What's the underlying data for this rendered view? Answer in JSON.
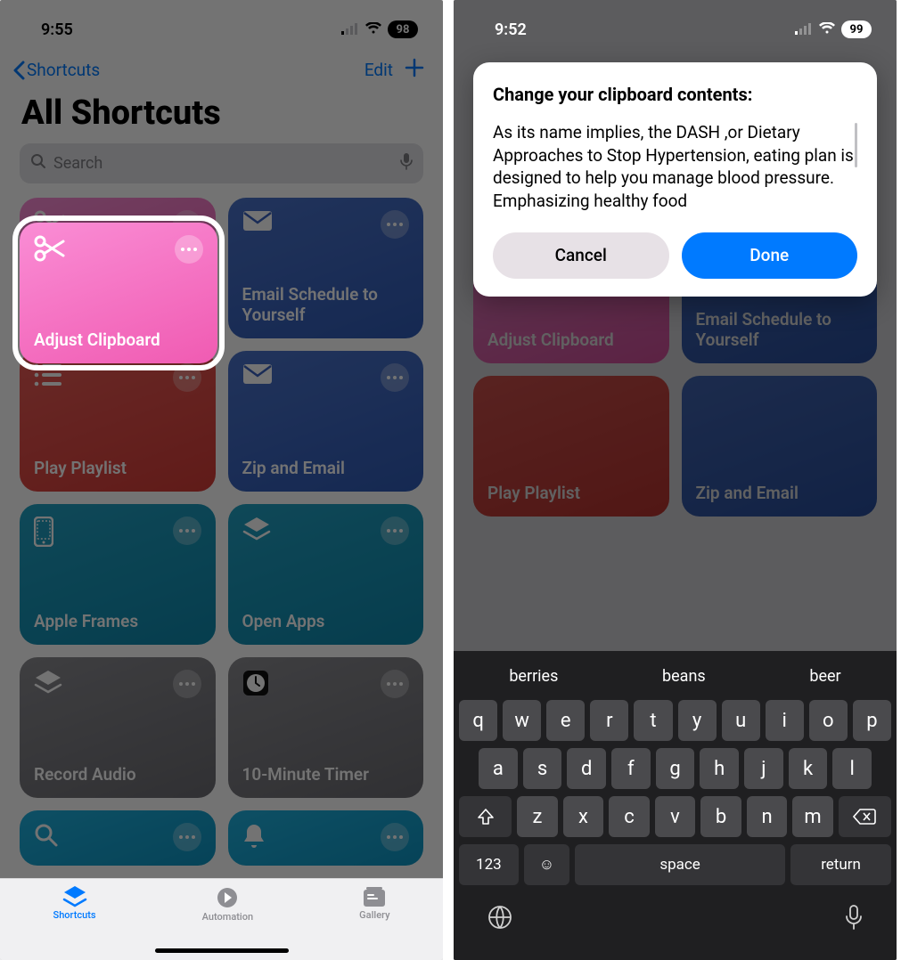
{
  "left": {
    "status": {
      "time": "9:55",
      "battery": "98"
    },
    "nav": {
      "back": "Shortcuts",
      "edit": "Edit"
    },
    "title": "All Shortcuts",
    "search": {
      "placeholder": "Search"
    },
    "cards": [
      {
        "label": "Adjust Clipboard"
      },
      {
        "label": "Email Schedule to Yourself"
      },
      {
        "label": "Play Playlist"
      },
      {
        "label": "Zip and Email"
      },
      {
        "label": "Apple Frames"
      },
      {
        "label": "Open Apps"
      },
      {
        "label": "Record Audio"
      },
      {
        "label": "10-Minute Timer"
      }
    ],
    "tabs": {
      "shortcuts": "Shortcuts",
      "automation": "Automation",
      "gallery": "Gallery"
    }
  },
  "right": {
    "status": {
      "time": "9:52",
      "battery": "99"
    },
    "dialog": {
      "title": "Change your clipboard contents:",
      "body": "As its name implies, the DASH ,or Dietary Approaches to Stop Hypertension, eating plan is designed to help you manage blood pressure. Emphasizing healthy food",
      "cancel": "Cancel",
      "done": "Done"
    },
    "bgcards": [
      {
        "label": "Adjust Clipboard"
      },
      {
        "label": "Email Schedule to Yourself"
      },
      {
        "label": "Play Playlist"
      },
      {
        "label": "Zip and Email"
      }
    ],
    "suggestions": [
      "berries",
      "beans",
      "beer"
    ],
    "keyboard": {
      "row1": [
        "q",
        "w",
        "e",
        "r",
        "t",
        "y",
        "u",
        "i",
        "o",
        "p"
      ],
      "row2": [
        "a",
        "s",
        "d",
        "f",
        "g",
        "h",
        "j",
        "k",
        "l"
      ],
      "row3": [
        "z",
        "x",
        "c",
        "v",
        "b",
        "n",
        "m"
      ],
      "numkey": "123",
      "space": "space",
      "return": "return"
    }
  }
}
